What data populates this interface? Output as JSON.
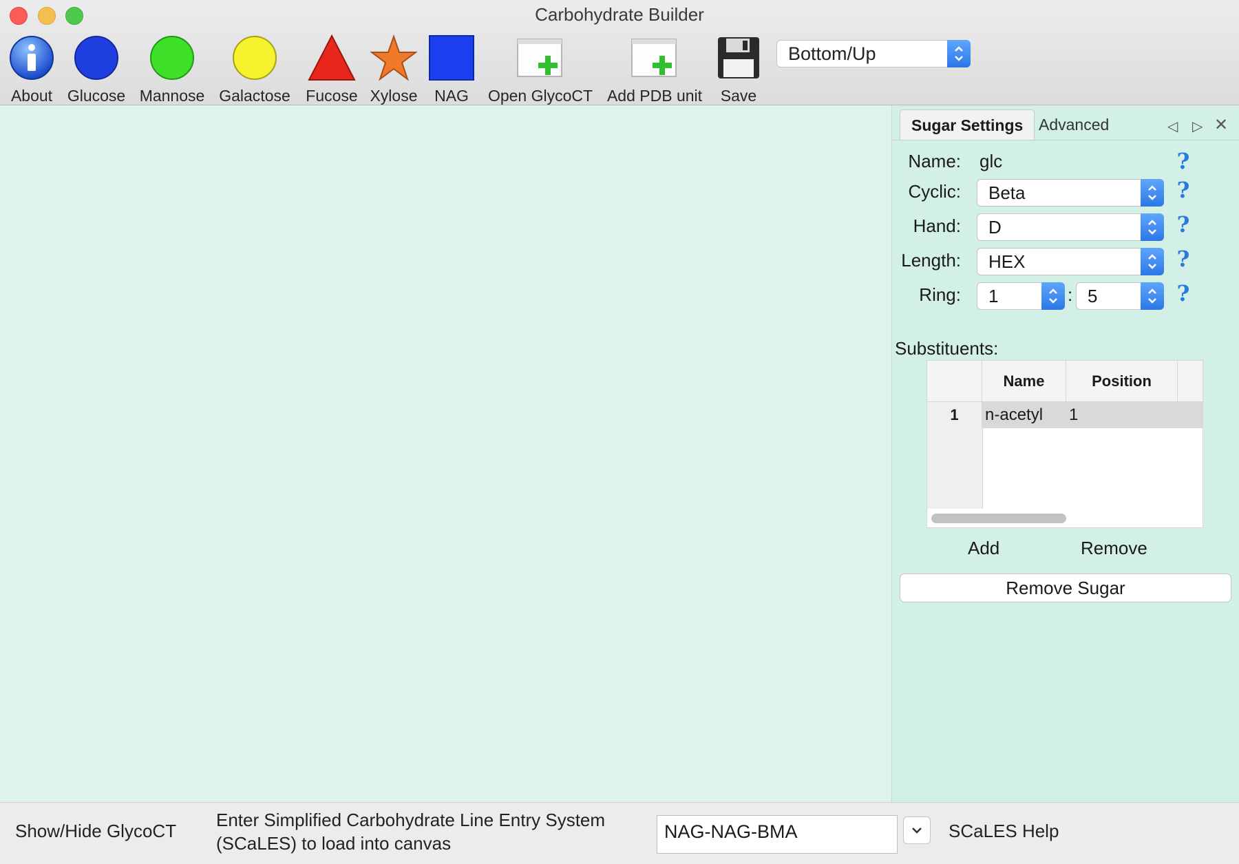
{
  "window": {
    "title": "Carbohydrate Builder"
  },
  "toolbar": {
    "items": [
      {
        "label": "About",
        "icon": "info-icon"
      },
      {
        "label": "Glucose",
        "icon": "blue-circle-icon",
        "color": "#1f3fe0"
      },
      {
        "label": "Mannose",
        "icon": "green-circle-icon",
        "color": "#3fe02a"
      },
      {
        "label": "Galactose",
        "icon": "yellow-circle-icon",
        "color": "#f5f22e"
      },
      {
        "label": "Fucose",
        "icon": "red-triangle-icon",
        "color": "#e8261b"
      },
      {
        "label": "Xylose",
        "icon": "orange-star-icon",
        "color": "#f07a2a"
      },
      {
        "label": "NAG",
        "icon": "blue-square-icon",
        "color": "#1c3ff0"
      },
      {
        "label": "Open GlycoCT",
        "icon": "open-file-icon"
      },
      {
        "label": "Add PDB unit",
        "icon": "add-file-icon"
      },
      {
        "label": "Save",
        "icon": "floppy-disk-icon"
      }
    ],
    "direction": "Bottom/Up"
  },
  "panel": {
    "tabs": {
      "active": "Sugar Settings",
      "inactive": "Advanced"
    },
    "name_label": "Name:",
    "name_value": "glc",
    "cyclic_label": "Cyclic:",
    "cyclic_value": "Beta",
    "hand_label": "Hand:",
    "hand_value": "D",
    "length_label": "Length:",
    "length_value": "HEX",
    "ring_label": "Ring:",
    "ring_start": "1",
    "ring_sep": ":",
    "ring_end": "5",
    "help_glyph": "?",
    "substituents_label": "Substituents:",
    "table": {
      "columns": [
        "Name",
        "Position"
      ],
      "rows": [
        {
          "index": "1",
          "name": "n-acetyl",
          "position": "1"
        }
      ]
    },
    "add_label": "Add",
    "remove_label": "Remove",
    "remove_sugar_label": "Remove Sugar"
  },
  "bottom": {
    "toggle_label": "Show/Hide GlycoCT",
    "prompt_line1": "Enter Simplified Carbohydrate Line Entry System",
    "prompt_line2": "(SCaLES) to load into canvas",
    "input_value": "NAG-NAG-BMA",
    "help_label": "SCaLES Help"
  }
}
